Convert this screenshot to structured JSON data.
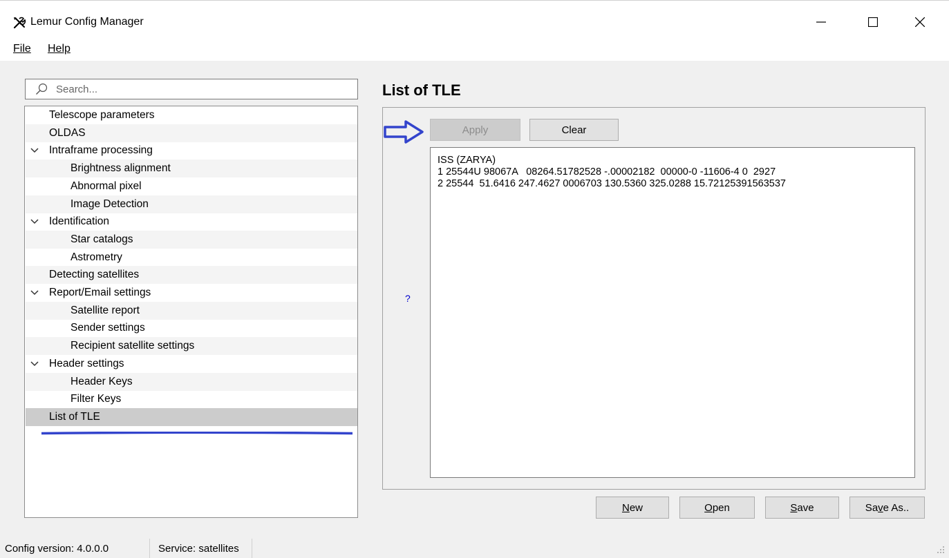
{
  "window": {
    "title": "Lemur Config Manager",
    "icon": "tools-icon",
    "minimize": "—",
    "maximize": "☐",
    "close": "✕"
  },
  "menubar": {
    "file": "File",
    "help": "Help"
  },
  "search": {
    "placeholder": "Search...",
    "value": ""
  },
  "tree": {
    "items": [
      {
        "label": "Telescope parameters",
        "level": 0
      },
      {
        "label": "OLDAS",
        "level": 0
      },
      {
        "label": "Intraframe processing",
        "level": 0,
        "expanded": true
      },
      {
        "label": "Brightness alignment",
        "level": 1
      },
      {
        "label": "Abnormal pixel",
        "level": 1
      },
      {
        "label": "Image Detection",
        "level": 1
      },
      {
        "label": "Identification",
        "level": 0,
        "expanded": true
      },
      {
        "label": "Star catalogs",
        "level": 1
      },
      {
        "label": "Astrometry",
        "level": 1
      },
      {
        "label": "Detecting satellites",
        "level": 0
      },
      {
        "label": "Report/Email settings",
        "level": 0,
        "expanded": true
      },
      {
        "label": "Satellite report",
        "level": 1
      },
      {
        "label": "Sender settings",
        "level": 1
      },
      {
        "label": "Recipient satellite settings",
        "level": 1
      },
      {
        "label": "Header settings",
        "level": 0,
        "expanded": true
      },
      {
        "label": "Header Keys",
        "level": 1
      },
      {
        "label": "Filter Keys",
        "level": 1
      },
      {
        "label": "List of TLE",
        "level": 0,
        "selected": true
      }
    ]
  },
  "panel": {
    "title": "List of TLE",
    "apply_label": "Apply",
    "clear_label": "Clear",
    "help_mark": "?",
    "tle_text": "ISS (ZARYA)\n1 25544U 98067A   08264.51782528 -.00002182  00000-0 -11606-4 0  2927\n2 25544  51.6416 247.4627 0006703 130.5360 325.0288 15.72125391563537"
  },
  "footer_buttons": {
    "new_label": "New",
    "open_label": "Open",
    "save_label": "Save",
    "save_as_label": "Save As.."
  },
  "status": {
    "config_version": "Config version: 4.0.0.0",
    "service": "Service: satellites"
  },
  "colors": {
    "annotation_blue": "#3344cc",
    "selection": "#cccccc",
    "background": "#f0f0f0"
  }
}
